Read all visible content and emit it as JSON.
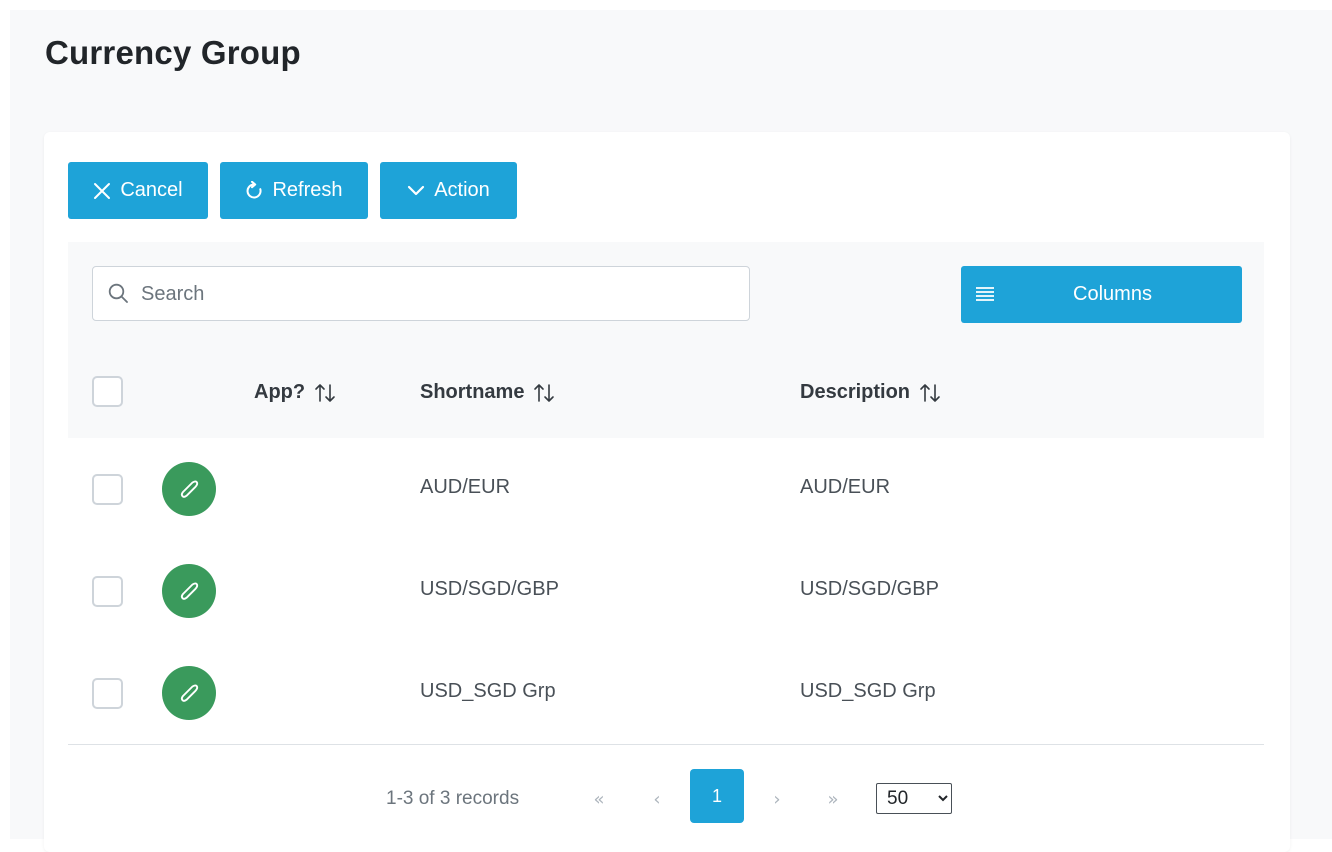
{
  "page": {
    "title": "Currency Group"
  },
  "toolbar": {
    "cancel_label": "Cancel",
    "refresh_label": "Refresh",
    "action_label": "Action"
  },
  "search": {
    "placeholder": "Search",
    "value": ""
  },
  "columns_button": {
    "label": "Columns"
  },
  "table": {
    "headers": {
      "app": "App?",
      "shortname": "Shortname",
      "description": "Description"
    },
    "rows": [
      {
        "shortname": "AUD/EUR",
        "description": "AUD/EUR"
      },
      {
        "shortname": "USD/SGD/GBP",
        "description": "USD/SGD/GBP"
      },
      {
        "shortname": "USD_SGD Grp",
        "description": "USD_SGD Grp"
      }
    ]
  },
  "pagination": {
    "info": "1-3 of 3 records",
    "current_page": "1",
    "page_size": "50",
    "page_size_options": [
      "50"
    ]
  },
  "colors": {
    "primary": "#1ea3d8",
    "edit": "#3a9a5c",
    "background": "#f8f9fa"
  },
  "icons": {
    "cancel": "close-icon",
    "refresh": "refresh-icon",
    "action": "chevron-down-icon",
    "search": "search-icon",
    "columns": "list-icon",
    "sort": "sort-icon",
    "edit": "pencil-icon"
  }
}
